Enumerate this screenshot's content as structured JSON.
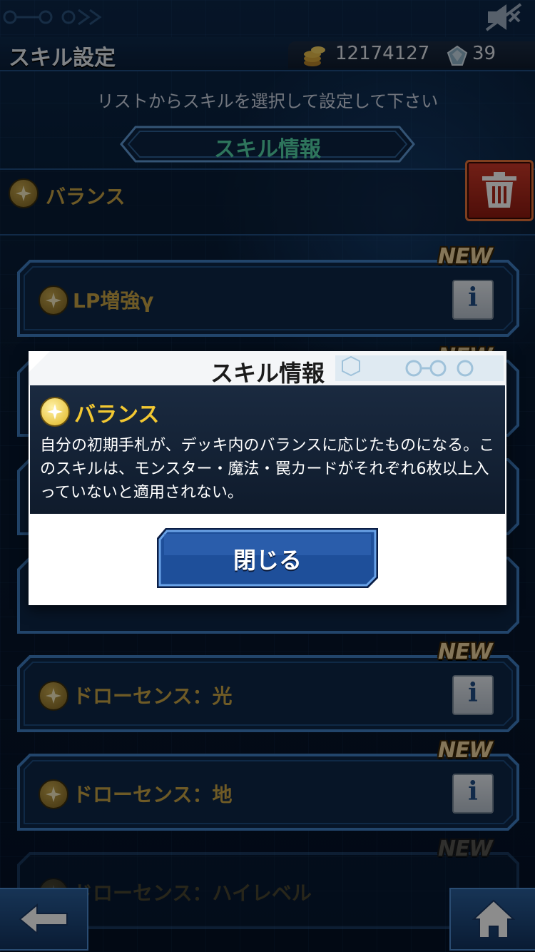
{
  "header": {
    "title": "スキル設定",
    "gold": "12174127",
    "gems": "39"
  },
  "instruction": "リストからスキルを選択して設定して下さい",
  "section_banner": "スキル情報",
  "current_skill": {
    "name": "バランス"
  },
  "skills": [
    {
      "name": "LP増強γ",
      "new_label": "NEW"
    },
    {
      "name": "",
      "new_label": "NEW"
    },
    {
      "name": "",
      "new_label": ""
    },
    {
      "name": "",
      "new_label": ""
    },
    {
      "name": "ドローセンス：光",
      "new_label": "NEW"
    },
    {
      "name": "ドローセンス：地",
      "new_label": "NEW"
    },
    {
      "name": "ドローセンス：ハイレベル",
      "new_label": "NEW"
    }
  ],
  "modal": {
    "title": "スキル情報",
    "skill_name": "バランス",
    "description": "自分の初期手札が、デッキ内のバランスに応じたものになる。このスキルは、モンスター・魔法・罠カードがそれぞれ6枚以上入っていないと適用されない。",
    "close_label": "閉じる"
  },
  "icons": {
    "gold": "coin-stack-icon",
    "gem": "crystal-icon",
    "trash": "trash-icon",
    "info": "info-icon",
    "back": "back-arrow-icon",
    "home": "home-icon",
    "skill": "star-icon",
    "mute": "mute-icon"
  },
  "colors": {
    "skill_gold": "#c9a445",
    "banner_green": "#54d6a8",
    "modal_skill_yellow": "#f3c832",
    "trash_red": "#cf3a2a",
    "button_blue": "#1e4f9a"
  }
}
